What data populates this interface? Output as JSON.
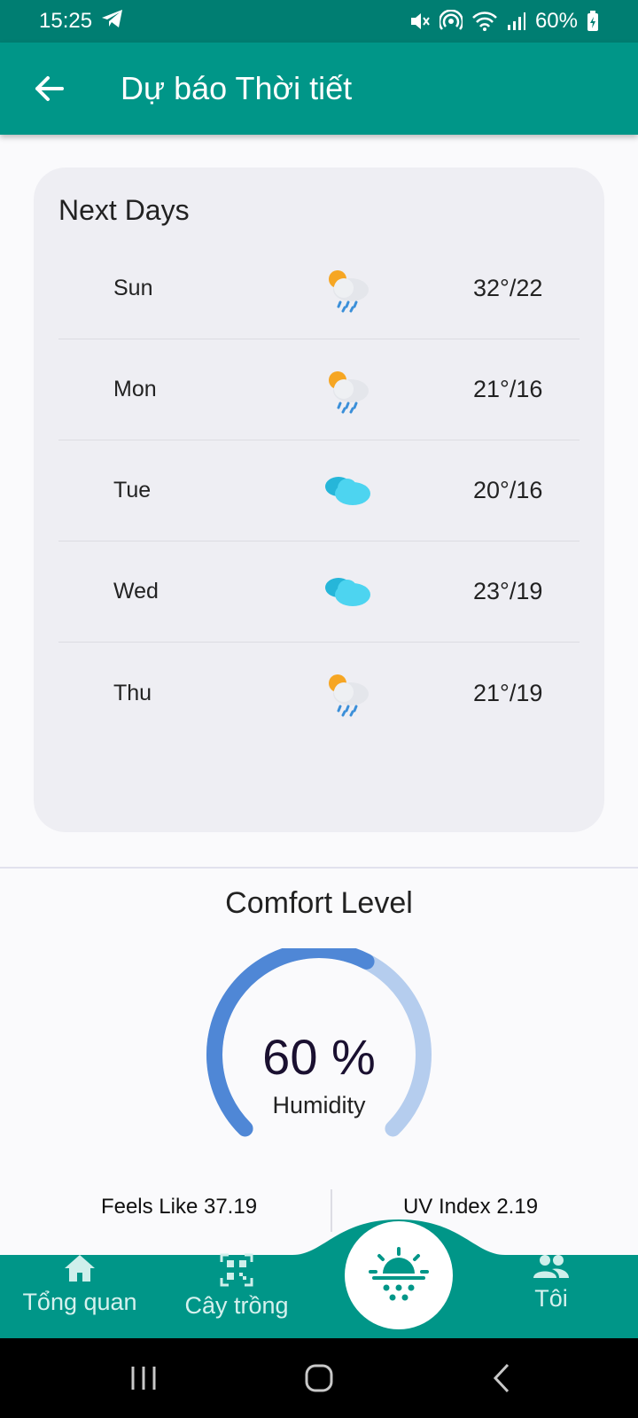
{
  "status_bar": {
    "time": "15:25",
    "battery": "60%"
  },
  "app_bar": {
    "title": "Dự báo Thời tiết"
  },
  "next_days": {
    "title": "Next Days",
    "days": [
      {
        "name": "Sun",
        "temp": "32°/22",
        "icon": "sun-cloud-rain-icon"
      },
      {
        "name": "Mon",
        "temp": "21°/16",
        "icon": "sun-cloud-rain-icon"
      },
      {
        "name": "Tue",
        "temp": "20°/16",
        "icon": "cloud-icon"
      },
      {
        "name": "Wed",
        "temp": "23°/19",
        "icon": "cloud-icon"
      },
      {
        "name": "Thu",
        "temp": "21°/19",
        "icon": "sun-cloud-rain-icon"
      }
    ]
  },
  "comfort": {
    "title": "Comfort Level",
    "humidity_value": "60 %",
    "humidity_fraction": 0.6,
    "humidity_label": "Humidity",
    "feels_like": "Feels Like 37.19",
    "uv_index": "UV Index 2.19"
  },
  "bottom_nav": {
    "items": [
      {
        "label": "Tổng quan",
        "icon": "home-icon"
      },
      {
        "label": "Cây trồng",
        "icon": "qr-code-icon"
      },
      {
        "label": "",
        "icon": "sunrise-weather-icon"
      },
      {
        "label": "Tôi",
        "icon": "people-icon"
      }
    ]
  },
  "colors": {
    "status_bar": "#007E72",
    "app_bar": "#009688",
    "card_bg": "#EEEEF3",
    "gauge_active": "#4F87D6",
    "gauge_track": "#B5CDEE"
  }
}
